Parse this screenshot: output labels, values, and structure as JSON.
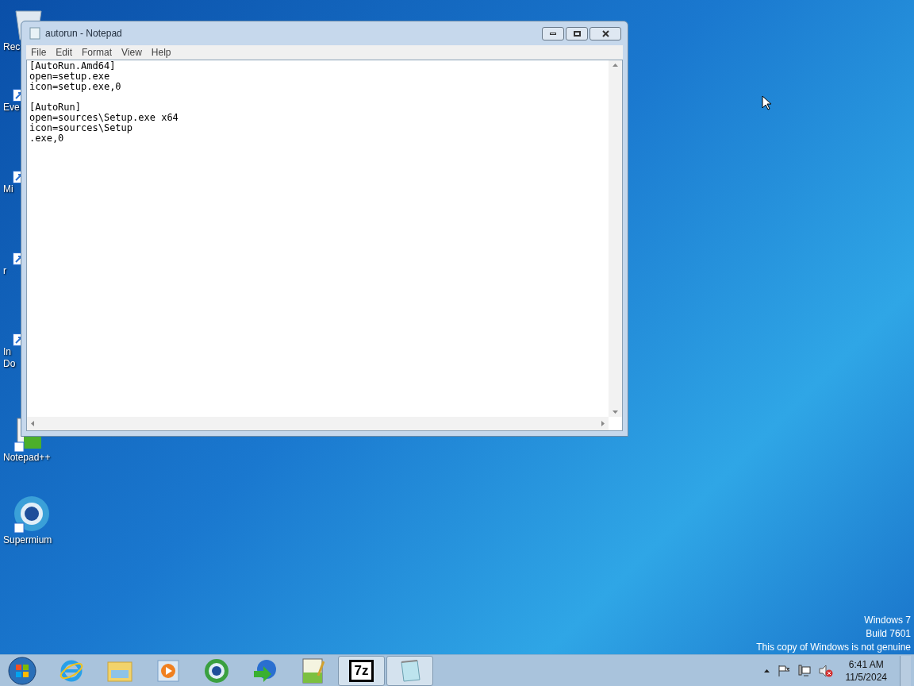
{
  "desktop_icons": [
    {
      "kind": "recycle",
      "label_lines": [
        "Rec"
      ]
    },
    {
      "kind": "shortcut",
      "label_lines": [
        "Eve"
      ]
    },
    {
      "kind": "shortcut",
      "label_lines": [
        "Mi"
      ]
    },
    {
      "kind": "shortcut",
      "label_lines": [
        "r"
      ]
    },
    {
      "kind": "shortcut",
      "label_lines": [
        "In",
        "Do"
      ]
    },
    {
      "kind": "notepadpp",
      "label_lines": [
        "Notepad++"
      ]
    },
    {
      "kind": "browser",
      "label_lines": [
        "Supermium"
      ]
    }
  ],
  "window": {
    "title": "autorun - Notepad",
    "menu": [
      "File",
      "Edit",
      "Format",
      "View",
      "Help"
    ],
    "sections": [
      [
        "[AutoRun.Amd64]",
        "open=setup.exe",
        "icon=setup.exe,0"
      ],
      [
        "[AutoRun]",
        "open=sources\\Setup.exe x64",
        "icon=sources\\Setup",
        ".exe,0"
      ]
    ]
  },
  "watermark_lines": [
    "Windows 7",
    "Build 7601",
    "This copy of Windows is not genuine"
  ],
  "taskbar": {
    "apps": [
      {
        "kind": "ie",
        "running": false
      },
      {
        "kind": "explorer",
        "running": false
      },
      {
        "kind": "media",
        "running": false
      },
      {
        "kind": "browser",
        "running": false
      },
      {
        "kind": "download",
        "running": false
      },
      {
        "kind": "notepadpp",
        "running": false
      },
      {
        "kind": "sevenzip",
        "label": "7z",
        "running": true
      },
      {
        "kind": "notepad",
        "running": true
      }
    ],
    "time": "6:41 AM",
    "date": "11/5/2024"
  }
}
